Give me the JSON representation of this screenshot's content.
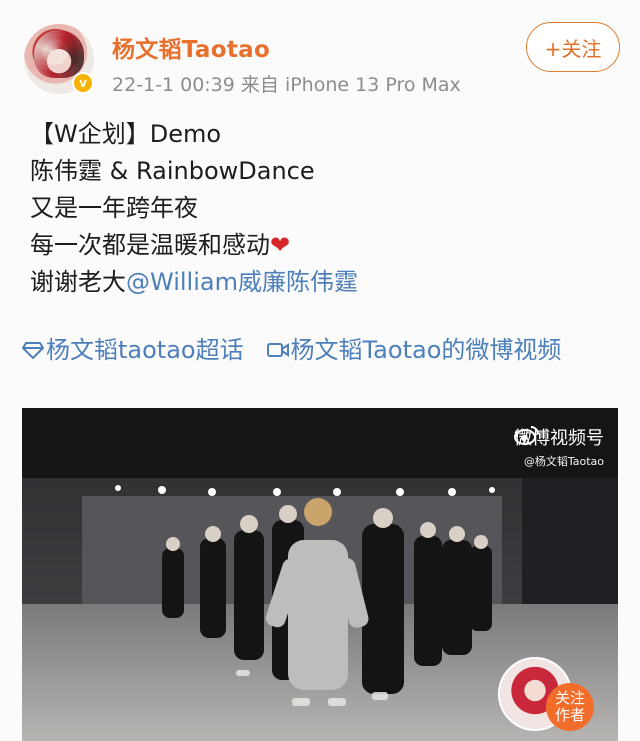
{
  "post": {
    "username": "杨文韬Taotao",
    "meta": "22-1-1 00:39  来自 iPhone 13 Pro Max",
    "follow_label": "+关注",
    "lines": [
      "【W企划】Demo",
      "陈伟霆 & RainbowDance",
      "又是一年跨年夜",
      "每一次都是温暖和感动"
    ],
    "heart": "❤",
    "thanks_prefix": "谢谢老大",
    "mention": "@William威廉陈伟霆",
    "topic_1": "杨文韬taotao超话",
    "topic_2": "杨文韬Taotao的微博视频"
  },
  "video": {
    "watermark_title": "微博视频号",
    "watermark_sub": "@杨文韬Taotao",
    "follow_author_label": "关注作者"
  },
  "colors": {
    "username": "#e8702c",
    "link": "#4d7fba",
    "follow_border": "#e07b2f",
    "badge": "#f36d2a"
  }
}
